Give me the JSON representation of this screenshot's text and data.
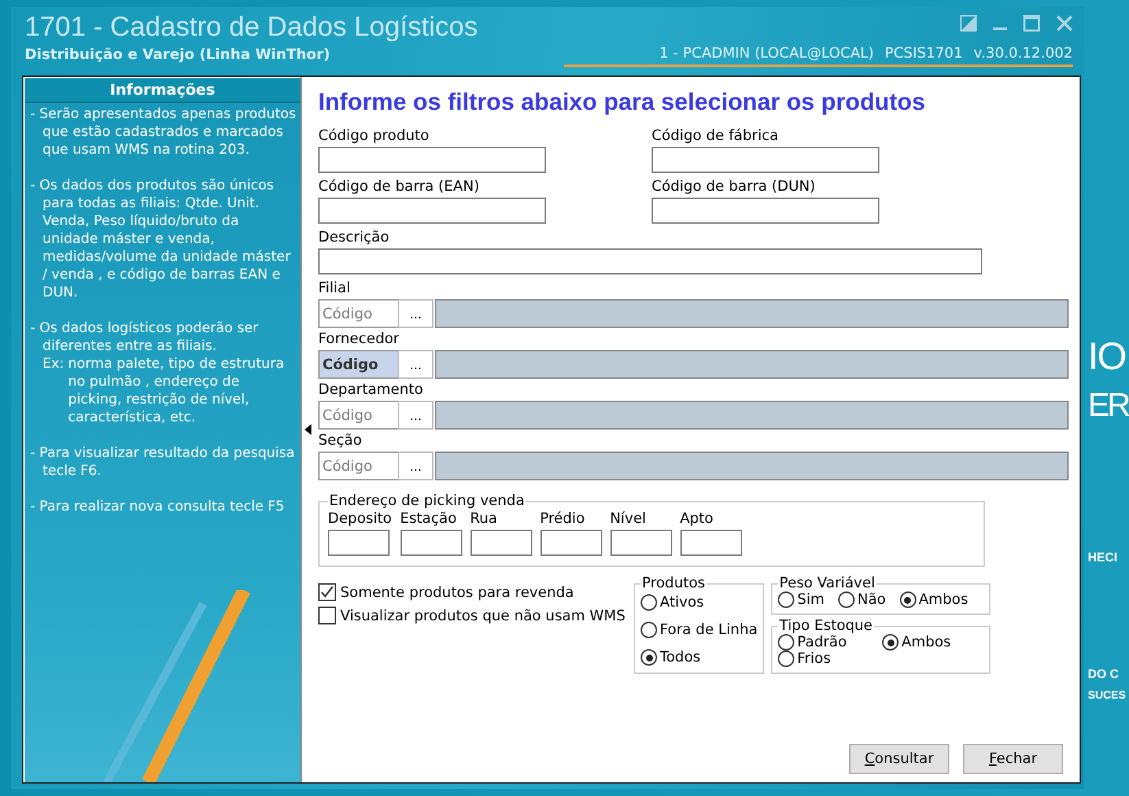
{
  "window": {
    "title": "1701 - Cadastro de Dados Logísticos",
    "subtitle": "Distribuição e Varejo (Linha WinThor)",
    "session": "1 - PCADMIN (LOCAL@LOCAL)",
    "routine": "PCSIS1701",
    "version": "v.30.0.12.002"
  },
  "background_texts": [
    "IO",
    "ER",
    "HECI",
    "DO C",
    "SUCES"
  ],
  "info_panel": {
    "title": "Informações",
    "items": [
      {
        "kind": "bullet",
        "text": "- Serão apresentados apenas produtos que estão cadastrados e marcados que usam WMS na rotina 203."
      },
      {
        "kind": "bullet",
        "text": "- Os dados dos produtos são únicos para todas as filiais: Qtde. Unit. Venda, Peso líquido/bruto da unidade máster e venda, medidas/volume da unidade máster / venda , e código de barras EAN e DUN."
      },
      {
        "kind": "bullet",
        "text": "- Os dados logísticos poderão ser diferentes entre as filiais."
      },
      {
        "kind": "example",
        "label": "Ex:",
        "text": "norma palete, tipo de estrutura no pulmão , endereço de picking, restrição de nível, característica, etc."
      },
      {
        "kind": "bullet",
        "text": "- Para visualizar resultado da pesquisa tecle F6."
      },
      {
        "kind": "bullet",
        "text": "- Para realizar nova consulta tecle F5"
      }
    ]
  },
  "heading": "Informe os filtros abaixo para selecionar os produtos",
  "text_fields": [
    {
      "label": "Código produto"
    },
    {
      "label": "Código de fábrica"
    },
    {
      "label": "Código de barra (EAN)"
    },
    {
      "label": "Código de barra (DUN)"
    }
  ],
  "description_field": {
    "label": "Descrição"
  },
  "lookups": [
    {
      "label": "Filial",
      "placeholder": "Código",
      "focused": false
    },
    {
      "label": "Fornecedor",
      "placeholder": "Código",
      "focused": true
    },
    {
      "label": "Departamento",
      "placeholder": "Código",
      "focused": false
    },
    {
      "label": "Seção",
      "placeholder": "Código",
      "focused": false
    }
  ],
  "lookup_button": "...",
  "picking": {
    "title": "Endereço de picking venda",
    "fields": [
      "Deposito",
      "Estação",
      "Rua",
      "Prédio",
      "Nível",
      "Apto"
    ]
  },
  "checkboxes": [
    {
      "label": "Somente produtos para revenda",
      "checked": true
    },
    {
      "label": "Visualizar produtos que não usam WMS",
      "checked": false
    }
  ],
  "produtos": {
    "title": "Produtos",
    "options": [
      {
        "label": "Ativos",
        "selected": false
      },
      {
        "label": "Fora de Linha",
        "selected": false
      },
      {
        "label": "Todos",
        "selected": true
      }
    ]
  },
  "peso_variavel": {
    "title": "Peso Variável",
    "options": [
      {
        "label": "Sim",
        "selected": false
      },
      {
        "label": "Não",
        "selected": false
      },
      {
        "label": "Ambos",
        "selected": true
      }
    ]
  },
  "tipo_estoque": {
    "title": "Tipo Estoque",
    "options": [
      {
        "label": "Padrão",
        "selected": false
      },
      {
        "label": "Ambos",
        "selected": true
      },
      {
        "label": "Frios",
        "selected": false
      }
    ]
  },
  "buttons": [
    {
      "label": "Consultar",
      "accelerator_underlined": true
    },
    {
      "label": "Fechar",
      "accelerator_underlined": true
    }
  ]
}
